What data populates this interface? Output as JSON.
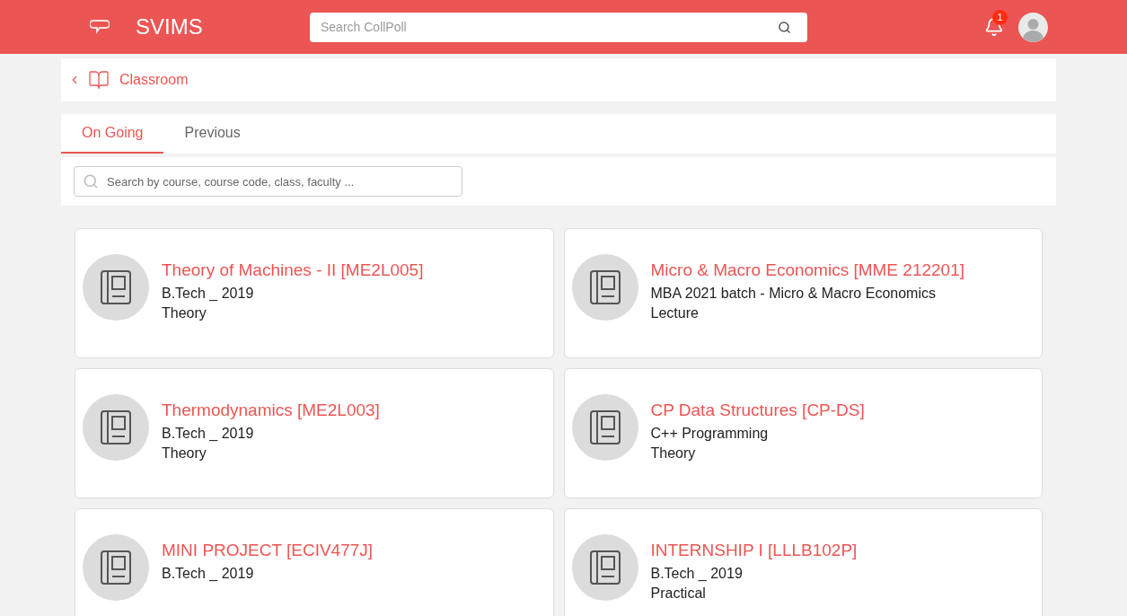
{
  "header": {
    "brand": "SVIMS",
    "search": {
      "placeholder": "Search CollPoll"
    },
    "notifications": "1"
  },
  "breadcrumb": {
    "title": "Classroom"
  },
  "tabs": [
    {
      "label": "On Going",
      "selected": true
    },
    {
      "label": "Previous",
      "selected": false
    }
  ],
  "filter": {
    "placeholder": "Search by course, course code, class, faculty ..."
  },
  "courses": [
    {
      "title": "Theory of Machines - II [ME2L005]",
      "lines": [
        "B.Tech _ 2019",
        "Theory"
      ]
    },
    {
      "title": "Micro & Macro Economics [MME 212201]",
      "lines": [
        "MBA 2021 batch - Micro & Macro Economics",
        "Lecture"
      ]
    },
    {
      "title": "Thermodynamics [ME2L003]",
      "lines": [
        "B.Tech _ 2019",
        "Theory"
      ]
    },
    {
      "title": "CP Data Structures [CP-DS]",
      "lines": [
        "C++ Programming",
        "Theory"
      ]
    },
    {
      "title": "MINI PROJECT [ECIV477J]",
      "lines": [
        "B.Tech _ 2019"
      ]
    },
    {
      "title": "INTERNSHIP I [LLLB102P]",
      "lines": [
        "B.Tech _ 2019",
        "Practical"
      ]
    }
  ]
}
